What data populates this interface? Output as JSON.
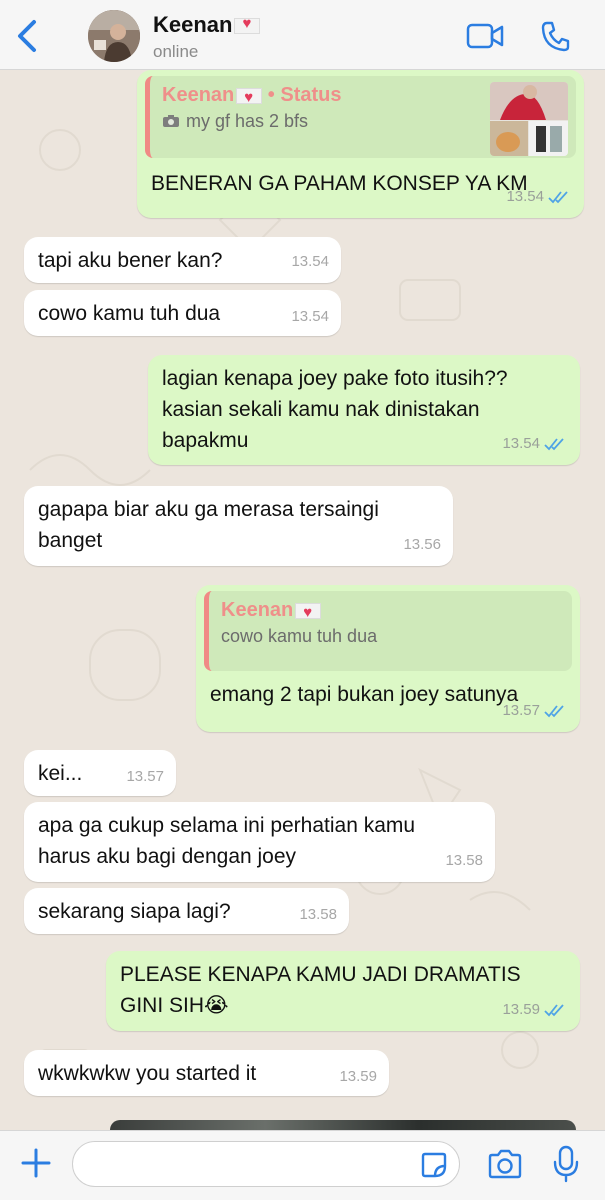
{
  "header": {
    "contact_name": "Keenan",
    "contact_status": "online",
    "back_icon": "chevron-left-icon",
    "video_icon": "video-icon",
    "call_icon": "phone-icon"
  },
  "messages": [
    {
      "direction": "out",
      "reply": {
        "author": "Keenan",
        "tag": " • Status",
        "text": "my gf has 2 bfs",
        "kind": "status"
      },
      "text": "BENERAN GA PAHAM KONSEP YA KM",
      "time": "13.54",
      "read": true
    },
    {
      "direction": "in",
      "text": "tapi aku bener kan?",
      "time": "13.54"
    },
    {
      "direction": "in",
      "text": "cowo kamu tuh dua",
      "time": "13.54"
    },
    {
      "direction": "out",
      "text": "lagian kenapa joey pake foto itusih??\nkasian sekali kamu nak dinistakan\nbapakmu",
      "time": "13.54",
      "read": true
    },
    {
      "direction": "in",
      "text": "gapapa biar aku ga merasa tersaingi\nbanget",
      "time": "13.56"
    },
    {
      "direction": "out",
      "reply": {
        "author": "Keenan",
        "text": "cowo kamu tuh dua"
      },
      "text": "emang 2 tapi bukan joey satunya",
      "time": "13.57",
      "read": true
    },
    {
      "direction": "in",
      "text": "kei...",
      "time": "13.57"
    },
    {
      "direction": "in",
      "text": "apa ga cukup selama ini perhatian kamu\nharus aku bagi dengan joey",
      "time": "13.58"
    },
    {
      "direction": "in",
      "text": "sekarang siapa lagi?",
      "time": "13.58"
    },
    {
      "direction": "out",
      "text": "PLEASE KENAPA KAMU JADI DRAMATIS\nGINI SIH😭",
      "time": "13.59",
      "read": true
    },
    {
      "direction": "in",
      "text": "wkwkwkw you started it",
      "time": "13.59"
    }
  ],
  "composer": {
    "plus_icon": "plus-icon",
    "sticker_icon": "sticker-icon",
    "camera_icon": "camera-icon",
    "mic_icon": "microphone-icon",
    "input_value": ""
  },
  "colors": {
    "accent": "#2b7de1",
    "outgoing_bubble": "#dcf8c6",
    "incoming_bubble": "#ffffff",
    "quote_author": "#ef8f8a"
  }
}
